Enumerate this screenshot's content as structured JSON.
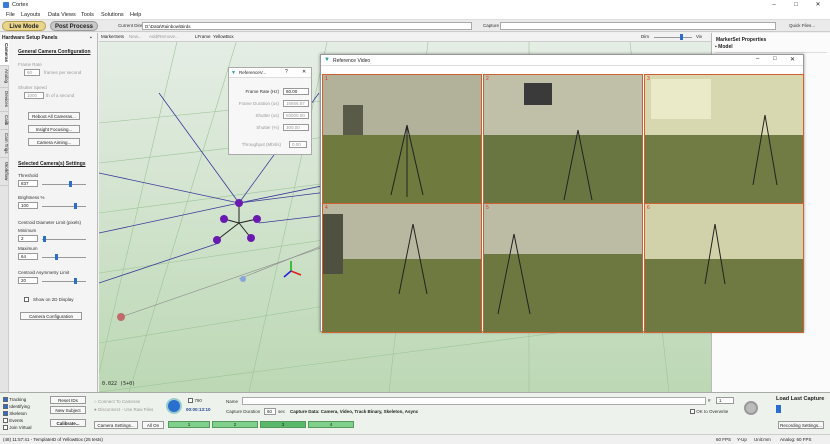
{
  "window": {
    "title": "Cortex"
  },
  "menu": [
    "File",
    "Layouts",
    "Data Views",
    "Tools",
    "Solutions",
    "Help"
  ],
  "toolbar": {
    "live_mode": "Live Mode",
    "post_process": "Post Process",
    "current_directory_label": "Current Directory",
    "current_directory_value": "D:\\Data\\Rainbow\\Birds",
    "capture_label": "Capture",
    "quick_files": "Quick Files..."
  },
  "left_panel": {
    "title": "Hardware Setup Panels",
    "tabs": [
      "Cameras",
      "Analog",
      "Devices",
      "Calib",
      "Cam Trigs",
      "Workflow"
    ],
    "general": {
      "heading": "General Camera Configuration",
      "frame_rate_label": "Frame Rate",
      "frame_rate_value": "60",
      "frame_rate_unit": "frames per second",
      "shutter_label": "Shutter Speed",
      "shutter_value": "1000",
      "shutter_unit": "th of a second",
      "reboot": "Reboot All Cameras...",
      "insight": "Insight Focusing...",
      "aiming": "Camera Aiming..."
    },
    "selected": {
      "heading": "Selected Camera(s) Settings",
      "threshold_label": "Threshold",
      "threshold_value": "837",
      "brightness_label": "Brightness %",
      "brightness_value": "100",
      "centroid_label": "Centroid Diameter Limit (pixels)",
      "minimum_label": "Minimum",
      "minimum_value": "2",
      "maximum_label": "Maximum",
      "maximum_value": "64",
      "asym_label": "Centroid Asymmetry Limit",
      "asym_value": "20",
      "show2d": "Show on 2D Display",
      "config": "Camera Configuration"
    }
  },
  "viewport": {
    "tabs": [
      "MarkerSets",
      "New...",
      "Add/Remove...",
      "LFrame",
      "YellowBox"
    ],
    "dim_label": "Dim",
    "viv_label": "Viv",
    "readout": "0.022 (5+0)"
  },
  "right_panel": {
    "title": "MarkerSet Properties",
    "model": "Model"
  },
  "ref_dialog": {
    "title": "ReferenceV...",
    "frame_rate_label": "Frame Rate (Hz)",
    "frame_rate_value": "60.00",
    "frame_duration_label": "Frame Duration (us)",
    "frame_duration_value": "16666.67",
    "shutter_label": "Shutter (us)",
    "shutter_value": "50000.00",
    "shutter2_label": "Shutter (%)",
    "shutter2_value": "300.00",
    "throughput_label": "Throughput (Mbit/s)",
    "throughput_value": "0.00"
  },
  "ref_video": {
    "title": "Reference Video",
    "cams": [
      "1",
      "2",
      "3",
      "4",
      "5",
      "6"
    ]
  },
  "bottom": {
    "tracking": "Tracking",
    "identifying": "Identifying",
    "skeleton": "Skeleton",
    "events": "Events",
    "join_virtual": "Join Virtual",
    "reset_ids": "Reset IDs",
    "new_subject": "New Subject",
    "calibrate": "Calibrate...",
    "connect": "Connect To Cameras",
    "disconnect": "Disconnect - Use Raw Files",
    "frame_count": "790",
    "timecode": "00:00:13:10",
    "camera_settings": "Camera Settings...",
    "all_on": "All On",
    "groups": [
      "1",
      "2",
      "3",
      "4"
    ],
    "name_label": "Name",
    "duration_label": "Capture Duration",
    "duration_value": "60",
    "duration_unit": "sec",
    "capture_data": "Capture Data: Camera, Video, Track Binary, Skeleton, Async",
    "ok_overwrite": "OK to Overwrite",
    "count_value": "1",
    "load_last": "Load Last Capture",
    "recording_settings": "Recording Settings..."
  },
  "status": {
    "left": "(48) 11:57:41 - TemplateID of YellowBox (25 tests)",
    "fps": "60 FPS",
    "yup": "Y-Up",
    "units": "Unit:mm",
    "analog": "Analog: 60 FPS"
  },
  "colors": {
    "accent": "#2a6fd0",
    "marker": "#6a1ab0",
    "floor": "#c9e0c4"
  }
}
